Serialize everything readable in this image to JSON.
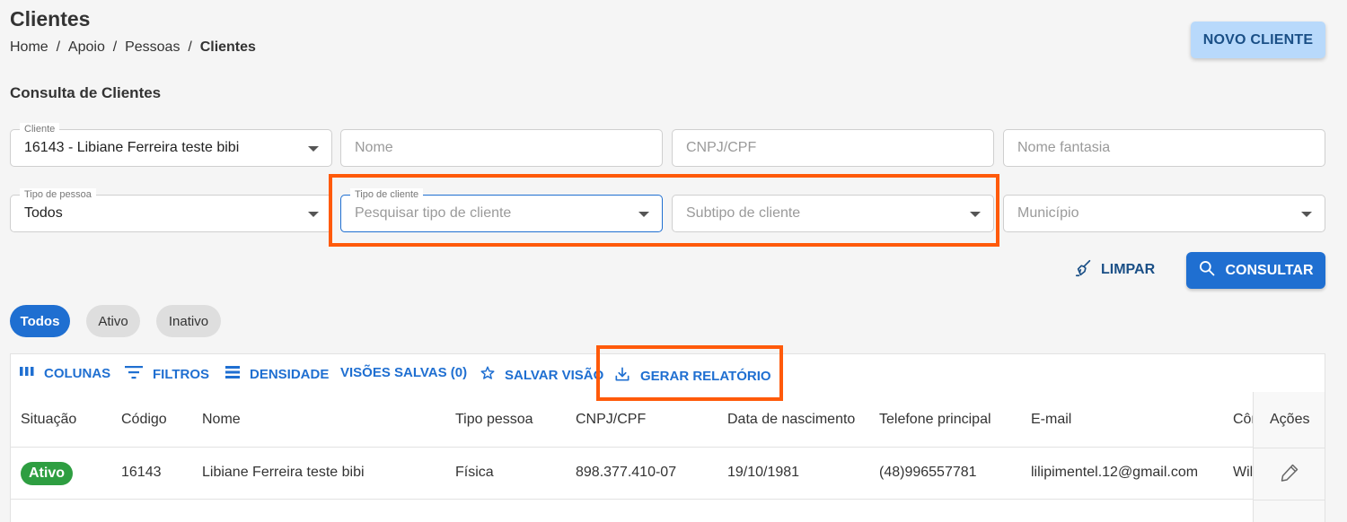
{
  "header": {
    "title": "Clientes",
    "breadcrumb": [
      "Home",
      "Apoio",
      "Pessoas",
      "Clientes"
    ],
    "new_button": "NOVO CLIENTE"
  },
  "filters": {
    "section_title": "Consulta de Clientes",
    "cliente": {
      "label": "Cliente",
      "value": "16143 - Libiane Ferreira teste bibi"
    },
    "nome": {
      "placeholder": "Nome"
    },
    "cnpj": {
      "placeholder": "CNPJ/CPF"
    },
    "fantasia": {
      "placeholder": "Nome fantasia"
    },
    "tipo_pessoa": {
      "label": "Tipo de pessoa",
      "value": "Todos"
    },
    "tipo_cliente": {
      "label": "Tipo de cliente",
      "placeholder": "Pesquisar tipo de cliente"
    },
    "subtipo": {
      "placeholder": "Subtipo de cliente"
    },
    "municipio": {
      "placeholder": "Município"
    },
    "clear_button": "LIMPAR",
    "search_button": "CONSULTAR"
  },
  "status_chips": [
    {
      "label": "Todos",
      "active": true
    },
    {
      "label": "Ativo",
      "active": false
    },
    {
      "label": "Inativo",
      "active": false
    }
  ],
  "toolbar": {
    "columns": "COLUNAS",
    "filters": "FILTROS",
    "density": "DENSIDADE",
    "saved_views": "VISÕES SALVAS (0)",
    "save_view": "SALVAR VISÃO",
    "report": "GERAR RELATÓRIO"
  },
  "table": {
    "columns": [
      "Situação",
      "Código",
      "Nome",
      "Tipo pessoa",
      "CNPJ/CPF",
      "Data de nascimento",
      "Telefone principal",
      "E-mail",
      "Côn"
    ],
    "actions_header": "Ações",
    "rows": [
      {
        "status": "Ativo",
        "code": "16143",
        "name": "Libiane Ferreira teste bibi",
        "person_type": "Física",
        "document": "898.377.410-07",
        "birth_date": "19/10/1981",
        "phone": "(48)996557781",
        "email": "lilipimentel.12@gmail.com",
        "spouse": "Wil"
      }
    ]
  },
  "colors": {
    "primary": "#1f6fd1",
    "highlight": "#ff5a0a",
    "active_badge": "#2e9e41"
  }
}
